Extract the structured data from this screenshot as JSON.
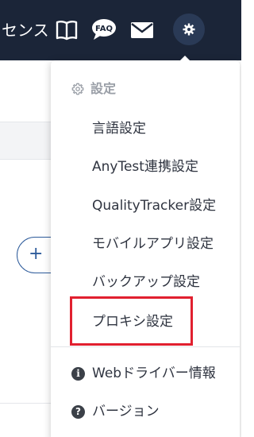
{
  "header": {
    "title": "センス",
    "icons": {
      "book": "book-open-icon",
      "faq": "faq-icon",
      "faq_text": "FAQ",
      "mail": "envelope-icon",
      "gear": "gear-icon"
    },
    "colors": {
      "background": "#1b2538",
      "gear_button": "#2a3a56"
    }
  },
  "background": {
    "add_button_symbol": "+"
  },
  "menu": {
    "header_label": "設定",
    "header_icon": "gear-outline-icon",
    "items": [
      {
        "label": "言語設定"
      },
      {
        "label": "AnyTest連携設定"
      },
      {
        "label": "QualityTracker設定"
      },
      {
        "label": "モバイルアプリ設定"
      },
      {
        "label": "バックアップ設定"
      },
      {
        "label": "プロキシ設定",
        "highlighted": true
      }
    ],
    "footer_items": [
      {
        "label": "Webドライバー情報",
        "icon": "info-circle-icon",
        "icon_text": "i"
      },
      {
        "label": "バージョン",
        "icon": "question-circle-icon",
        "icon_text": "?"
      }
    ],
    "highlight_color": "#e1202f"
  }
}
